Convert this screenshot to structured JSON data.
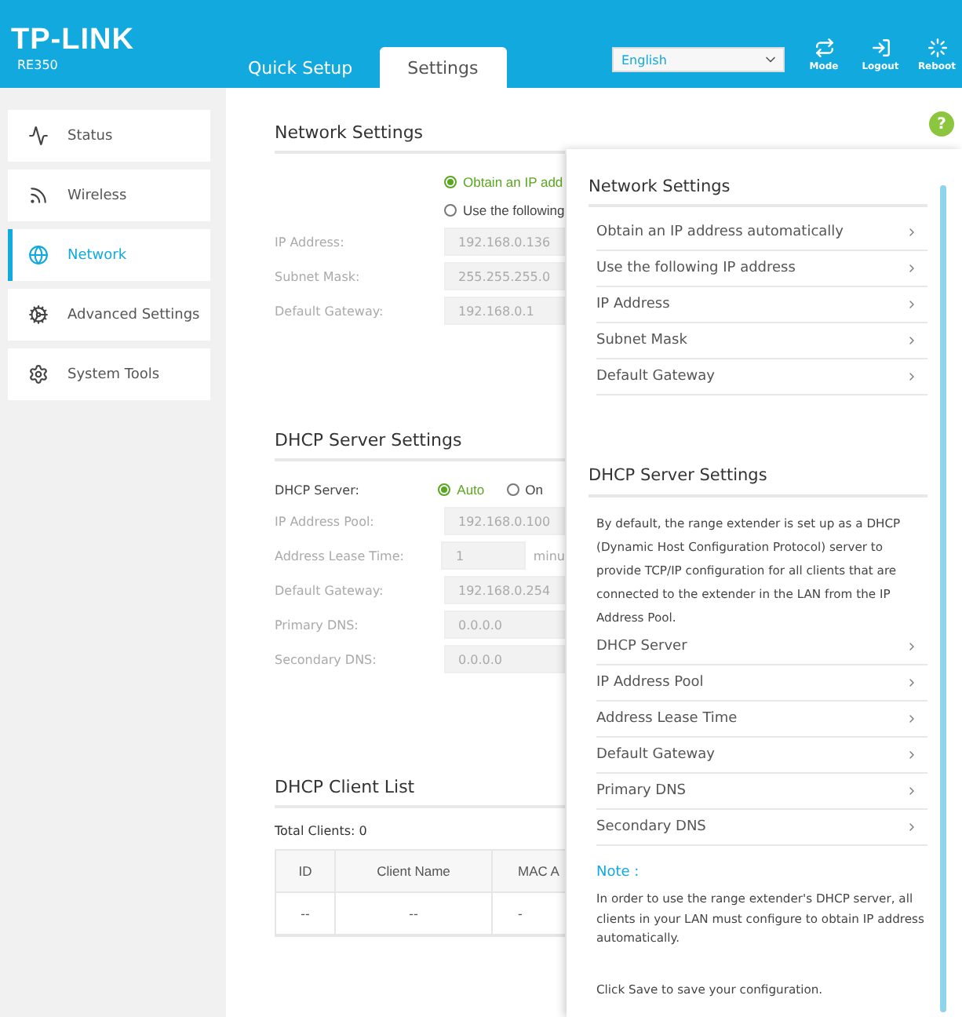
{
  "header": {
    "logo": "TP-LINK",
    "model": "RE350",
    "language": "English",
    "tabs": [
      {
        "label": "Quick Setup",
        "selected": false
      },
      {
        "label": "Settings",
        "selected": true
      }
    ],
    "actions": [
      {
        "label": "Mode",
        "kind": "mode"
      },
      {
        "label": "Logout",
        "kind": "logout"
      },
      {
        "label": "Reboot",
        "kind": "reboot"
      }
    ]
  },
  "sidebar": {
    "items": [
      {
        "label": "Status",
        "kind": "status",
        "selected": false
      },
      {
        "label": "Wireless",
        "kind": "wireless",
        "selected": false
      },
      {
        "label": "Network",
        "kind": "network",
        "selected": true
      },
      {
        "label": "Advanced Settings",
        "kind": "advanced",
        "selected": false
      },
      {
        "label": "System Tools",
        "kind": "tools",
        "selected": false
      }
    ]
  },
  "network": {
    "title": "Network Settings",
    "radios": [
      {
        "label": "Obtain an IP add",
        "selected": true
      },
      {
        "label": "Use the following",
        "selected": false
      }
    ],
    "fields": [
      {
        "label": "IP Address:",
        "value": "192.168.0.136",
        "disabled": true
      },
      {
        "label": "Subnet Mask:",
        "value": "255.255.255.0",
        "disabled": true
      },
      {
        "label": "Default Gateway:",
        "value": "192.168.0.1",
        "disabled": true
      }
    ]
  },
  "dhcp": {
    "title": "DHCP Server Settings",
    "server_label": "DHCP Server:",
    "options": [
      {
        "label": "Auto",
        "selected": true
      },
      {
        "label": "On",
        "selected": false
      }
    ],
    "fields": [
      {
        "label": "IP Address Pool:",
        "value": "192.168.0.100",
        "disabled": true
      },
      {
        "label": "Address Lease Time:",
        "value": "1",
        "unit": "minu",
        "disabled": true
      },
      {
        "label": "Default Gateway:",
        "value": "192.168.0.254",
        "disabled": true
      },
      {
        "label": "Primary DNS:",
        "value": "0.0.0.0",
        "disabled": true
      },
      {
        "label": "Secondary DNS:",
        "value": "0.0.0.0",
        "disabled": true
      }
    ]
  },
  "client_list": {
    "title": "DHCP Client List",
    "total": "Total Clients: 0",
    "columns": [
      "ID",
      "Client Name",
      "MAC A"
    ],
    "rows": [
      [
        "--",
        "--",
        "-"
      ]
    ]
  },
  "help": {
    "button": "?",
    "sections": [
      {
        "title": "Network Settings",
        "items": [
          "Obtain an IP address automatically",
          "Use the following IP address",
          "IP Address",
          "Subnet Mask",
          "Default Gateway"
        ]
      },
      {
        "title": "DHCP Server Settings",
        "paragraph": "By default, the range extender is set up as a DHCP (Dynamic Host Configuration Protocol) server to provide TCP/IP configuration for all clients that are connected to the extender in the LAN from the IP Address Pool.",
        "items": [
          "DHCP Server",
          "IP Address Pool",
          "Address Lease Time",
          "Default Gateway",
          "Primary DNS",
          "Secondary DNS"
        ]
      }
    ],
    "note_title": "Note :",
    "note": "In order to use the range extender's DHCP server, all clients in your LAN must configure to obtain IP address automatically.",
    "footer": "Click Save to save your configuration."
  }
}
